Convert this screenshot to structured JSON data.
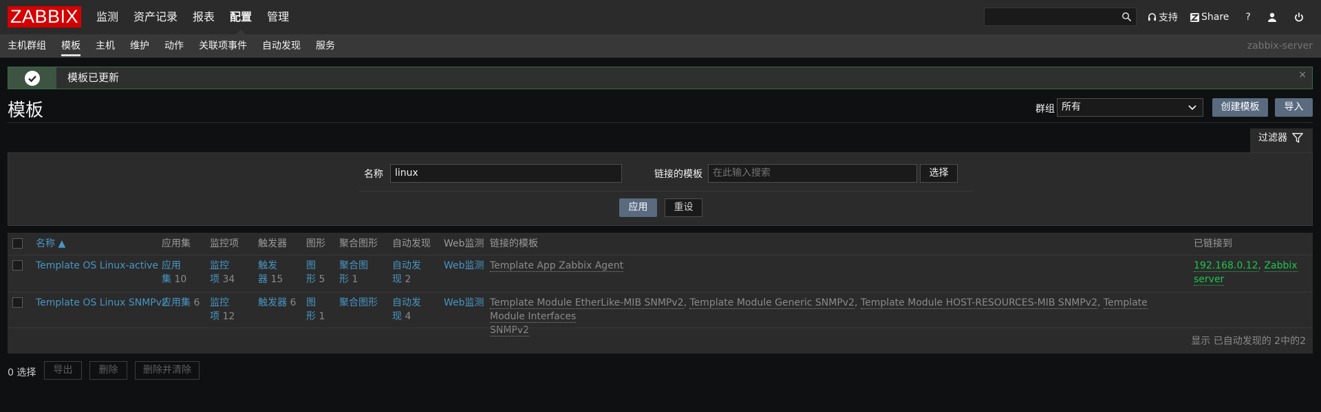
{
  "topbar": {
    "logo": "ZABBIX",
    "menu": [
      "监测",
      "资产记录",
      "报表",
      "配置",
      "管理"
    ],
    "active_menu": "配置",
    "support": "支持",
    "share": "Share",
    "help": "?"
  },
  "subbar": {
    "items": [
      "主机群组",
      "模板",
      "主机",
      "维护",
      "动作",
      "关联项事件",
      "自动发现",
      "服务"
    ],
    "active": "模板",
    "server": "zabbix-server"
  },
  "message": {
    "text": "模板已更新",
    "close": "×"
  },
  "header": {
    "title": "模板",
    "group_label": "群组",
    "group_value": "所有",
    "create_btn": "创建模板",
    "import_btn": "导入"
  },
  "filter": {
    "tab_label": "过滤器",
    "name_label": "名称",
    "name_value": "linux",
    "linked_label": "链接的模板",
    "linked_placeholder": "在此输入搜索",
    "select_btn": "选择",
    "apply_btn": "应用",
    "reset_btn": "重设"
  },
  "table": {
    "headers": {
      "name": "名称 ▲",
      "apps": "应用集",
      "items": "监控项",
      "triggers": "触发器",
      "graphs": "图形",
      "screens": "聚合图形",
      "discovery": "自动发现",
      "web": "Web监测",
      "linked": "链接的模板",
      "linked_to": "已链接到"
    },
    "rows": [
      {
        "name": "Template OS Linux-active",
        "apps_l1": "应用",
        "apps_l2": "集",
        "apps_cnt": "10",
        "items_l1": "监控",
        "items_l2": "项",
        "items_cnt": "34",
        "trig_l1": "触发",
        "trig_l2": "器",
        "trig_cnt": "15",
        "graph_l1": "图",
        "graph_l2": "形",
        "graph_cnt": "5",
        "screen_l1": "聚合图",
        "screen_l2": "形",
        "screen_cnt": "1",
        "disc_l1": "自动发",
        "disc_l2": "现",
        "disc_cnt": "2",
        "web": "Web监测",
        "linked_1": "Template App Zabbix Agent",
        "linked_to_1": "192.168.0.12",
        "linked_to_2": "Zabbix",
        "linked_to_3": "server"
      },
      {
        "name": "Template OS Linux SNMPv2",
        "apps": "应用集",
        "apps_cnt": "6",
        "items_l1": "监控",
        "items_l2": "项",
        "items_cnt": "12",
        "trig": "触发器",
        "trig_cnt": "6",
        "graph_l1": "图",
        "graph_l2": "形",
        "graph_cnt": "1",
        "screen": "聚合图形",
        "disc_l1": "自动发",
        "disc_l2": "现",
        "disc_cnt": "4",
        "web": "Web监测",
        "linked_1": "Template Module EtherLike-MIB SNMPv2",
        "linked_2": "Template Module Generic SNMPv2",
        "linked_3": "Template Module HOST-RESOURCES-MIB SNMPv2",
        "linked_4": "Template Module Interfaces",
        "linked_4b": "SNMPv2"
      }
    ],
    "footer": "显示 已自动发现的 2中的2"
  },
  "actions": {
    "selected": "0 选择",
    "export": "导出",
    "delete": "删除",
    "delete_clear": "删除并清除"
  },
  "colors": {
    "accent_link": "#4796c4",
    "brand_red": "#d40000",
    "success_green": "#1dc54f",
    "button_blue": "#5a6b80"
  }
}
